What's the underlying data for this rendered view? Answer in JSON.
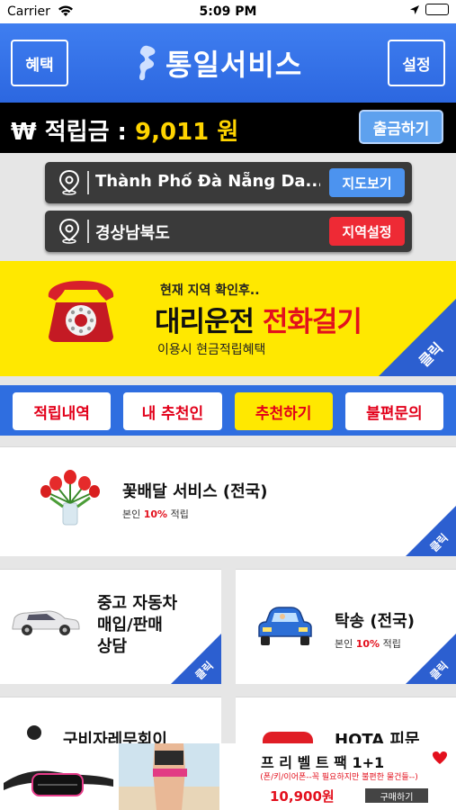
{
  "status_bar": {
    "carrier": "Carrier",
    "time": "5:09 PM"
  },
  "header": {
    "left_button": "혜택",
    "title": "통일서비스",
    "right_button": "설정"
  },
  "balance": {
    "currency_symbol": "₩",
    "label": "적립금 :",
    "amount": "9,011",
    "unit": "원",
    "withdraw_label": "출금하기"
  },
  "locations": [
    {
      "text": "Thành Phố Đà Nẵng Da...",
      "button": "지도보기",
      "button_color": "#4c93ef"
    },
    {
      "text": "경상남북도",
      "button": "지역설정",
      "button_color": "#ee2a35"
    }
  ],
  "banner": {
    "line1": "현재 지역 확인후..",
    "line2_a": "대리운전 ",
    "line2_b": "전화걸기",
    "line3": "이용시 현금적립혜택",
    "corner": "클릭"
  },
  "tabs": [
    {
      "label": "적립내역",
      "active": false
    },
    {
      "label": "내 추천인",
      "active": false
    },
    {
      "label": "추천하기",
      "active": true
    },
    {
      "label": "불편문의",
      "active": false
    }
  ],
  "cards": {
    "flower": {
      "title": "꽃배달 서비스 (전국)",
      "sub_a": "본인 ",
      "sub_b": "10%",
      "sub_c": " 적립",
      "corner": "클릭"
    },
    "usedcar": {
      "title_1": "중고 자동차",
      "title_2": "매입/판매",
      "title_3": "상담",
      "corner": "클릭"
    },
    "tow": {
      "title": "탁송 (전국)",
      "sub_a": "본인 ",
      "sub_b": "10%",
      "sub_c": " 적립",
      "corner": "클릭"
    },
    "partial_left": "구비자레무회이",
    "partial_right": "HOTA 피문"
  },
  "ad": {
    "title": "프 리 벨 트 팩 1+1",
    "subtitle": "(폰/키/이어폰--꼭 필요하지만 불편한 물건들--)",
    "price": "10,900원",
    "buy": "구매하기"
  },
  "colors": {
    "accent_blue": "#2f6ee0",
    "yellow": "#ffe800",
    "red": "#e3101d"
  }
}
